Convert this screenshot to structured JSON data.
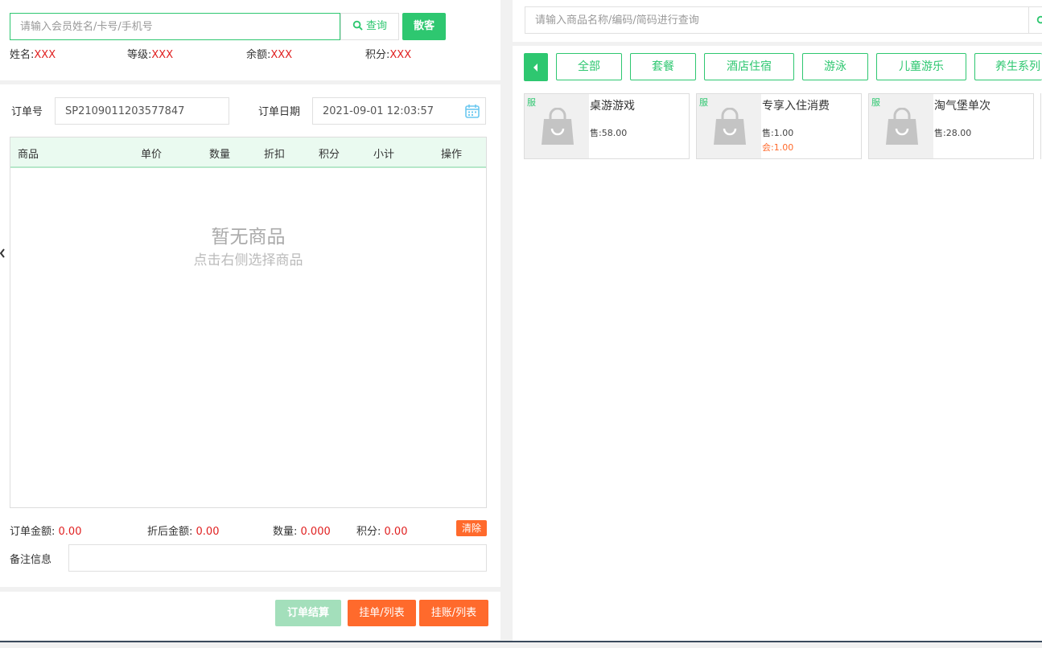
{
  "member": {
    "search_placeholder": "请输入会员姓名/卡号/手机号",
    "query_label": "查询",
    "walkin_label": "散客",
    "name_label": "姓名:",
    "name_value": "XXX",
    "level_label": "等级:",
    "level_value": "XXX",
    "balance_label": "余额:",
    "balance_value": "XXX",
    "points_label": "积分:",
    "points_value": "XXX"
  },
  "order": {
    "number_label": "订单号",
    "number_value": "SP2109011203577847",
    "date_label": "订单日期",
    "date_value": "2021-09-01 12:03:57",
    "columns": [
      "商品",
      "单价",
      "数量",
      "折扣",
      "积分",
      "小计",
      "操作"
    ],
    "empty_title": "暂无商品",
    "empty_subtitle": "点击右侧选择商品",
    "total_label": "订单金额:",
    "total_value": "0.00",
    "discounted_label": "折后金额:",
    "discounted_value": "0.00",
    "qty_label": "数量:",
    "qty_value": "0.000",
    "points_label": "积分:",
    "points_value": "0.00",
    "clear_label": "清除",
    "remark_label": "备注信息",
    "remark_value": "",
    "checkout_label": "订单结算",
    "hold_label": "挂单/列表",
    "credit_label": "挂账/列表"
  },
  "products": {
    "search_placeholder": "请输入商品名称/编码/简码进行查询",
    "categories": [
      "全部",
      "套餐",
      "酒店住宿",
      "游泳",
      "儿童游乐",
      "养生系列"
    ],
    "items": [
      {
        "tag": "服",
        "name": "桌游游戏",
        "sell": "售:58.00",
        "member": ""
      },
      {
        "tag": "服",
        "name": "专享入住消费",
        "sell": "售:1.00",
        "member": "会:1.00"
      },
      {
        "tag": "服",
        "name": "淘气堡单次",
        "sell": "售:28.00",
        "member": ""
      }
    ]
  },
  "colors": {
    "accent": "#2ec770",
    "warning": "#ff6a2c",
    "value_red": "#e02020"
  },
  "icons": [
    "search-icon",
    "calendar-icon",
    "shopping-bag-icon",
    "caret-left-icon",
    "collapse-arrow-icon"
  ]
}
